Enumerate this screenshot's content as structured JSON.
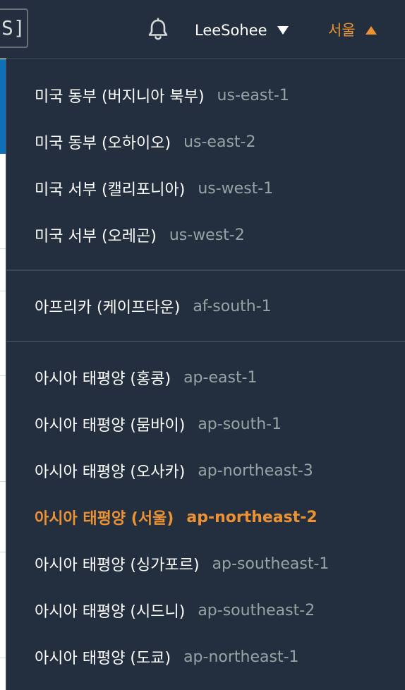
{
  "topbar": {
    "search_fragment": "S]",
    "bell_icon": "bell-icon",
    "username": "LeeSohee",
    "region_label": "서울"
  },
  "regions": {
    "groups": [
      [
        {
          "name": "미국 동부 (버지니아 북부)",
          "code": "us-east-1"
        },
        {
          "name": "미국 동부 (오하이오)",
          "code": "us-east-2"
        },
        {
          "name": "미국 서부 (캘리포니아)",
          "code": "us-west-1"
        },
        {
          "name": "미국 서부 (오레곤)",
          "code": "us-west-2"
        }
      ],
      [
        {
          "name": "아프리카 (케이프타운)",
          "code": "af-south-1"
        }
      ],
      [
        {
          "name": "아시아 태평양 (홍콩)",
          "code": "ap-east-1"
        },
        {
          "name": "아시아 태평양 (뭄바이)",
          "code": "ap-south-1"
        },
        {
          "name": "아시아 태평양 (오사카)",
          "code": "ap-northeast-3"
        },
        {
          "name": "아시아 태평양 (서울)",
          "code": "ap-northeast-2",
          "selected": true
        },
        {
          "name": "아시아 태평양 (싱가포르)",
          "code": "ap-southeast-1"
        },
        {
          "name": "아시아 태평양 (시드니)",
          "code": "ap-southeast-2"
        },
        {
          "name": "아시아 태평양 (도쿄)",
          "code": "ap-northeast-1"
        }
      ]
    ]
  },
  "colors": {
    "background": "#232f3e",
    "accent": "#ec9233",
    "text": "#ffffff",
    "muted": "#95a5a6"
  }
}
